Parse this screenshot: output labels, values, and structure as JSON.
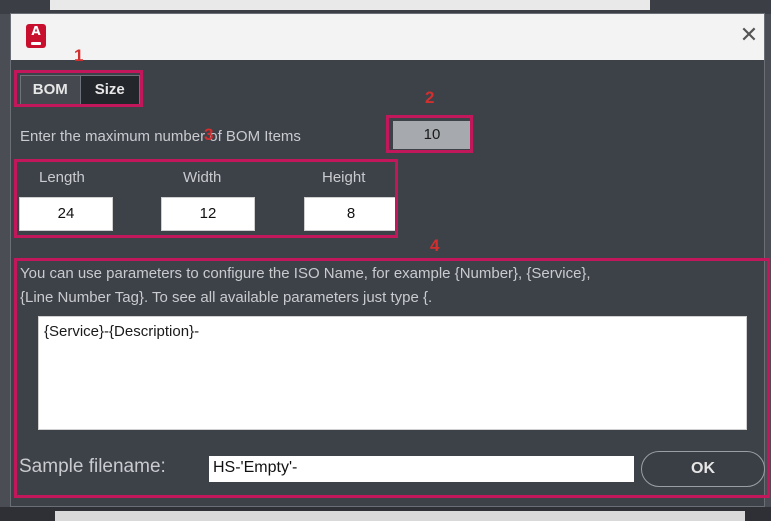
{
  "window": {
    "app_icon_glyph": "A",
    "close_glyph": "✕"
  },
  "tabs": [
    {
      "label": "BOM"
    },
    {
      "label": "Size"
    }
  ],
  "bom": {
    "max_label": "Enter the maximum number of BOM Items",
    "max_value": "10"
  },
  "size": {
    "length_label": "Length",
    "width_label": "Width",
    "height_label": "Height",
    "length_value": "24",
    "width_value": "12",
    "height_value": "8"
  },
  "iso": {
    "help_line1": "You can use parameters to configure the ISO Name, for example {Number}, {Service},",
    "help_line2": "{Line Number Tag}.  To see all available parameters just type {.",
    "template_value": "{Service}-{Description}-",
    "sample_label": "Sample filename:",
    "sample_value": "HS-'Empty'-",
    "ok_label": "OK"
  },
  "annotations": {
    "n1": "1",
    "n2": "2",
    "n3": "3",
    "n4": "4",
    "color": "#c2185b"
  }
}
